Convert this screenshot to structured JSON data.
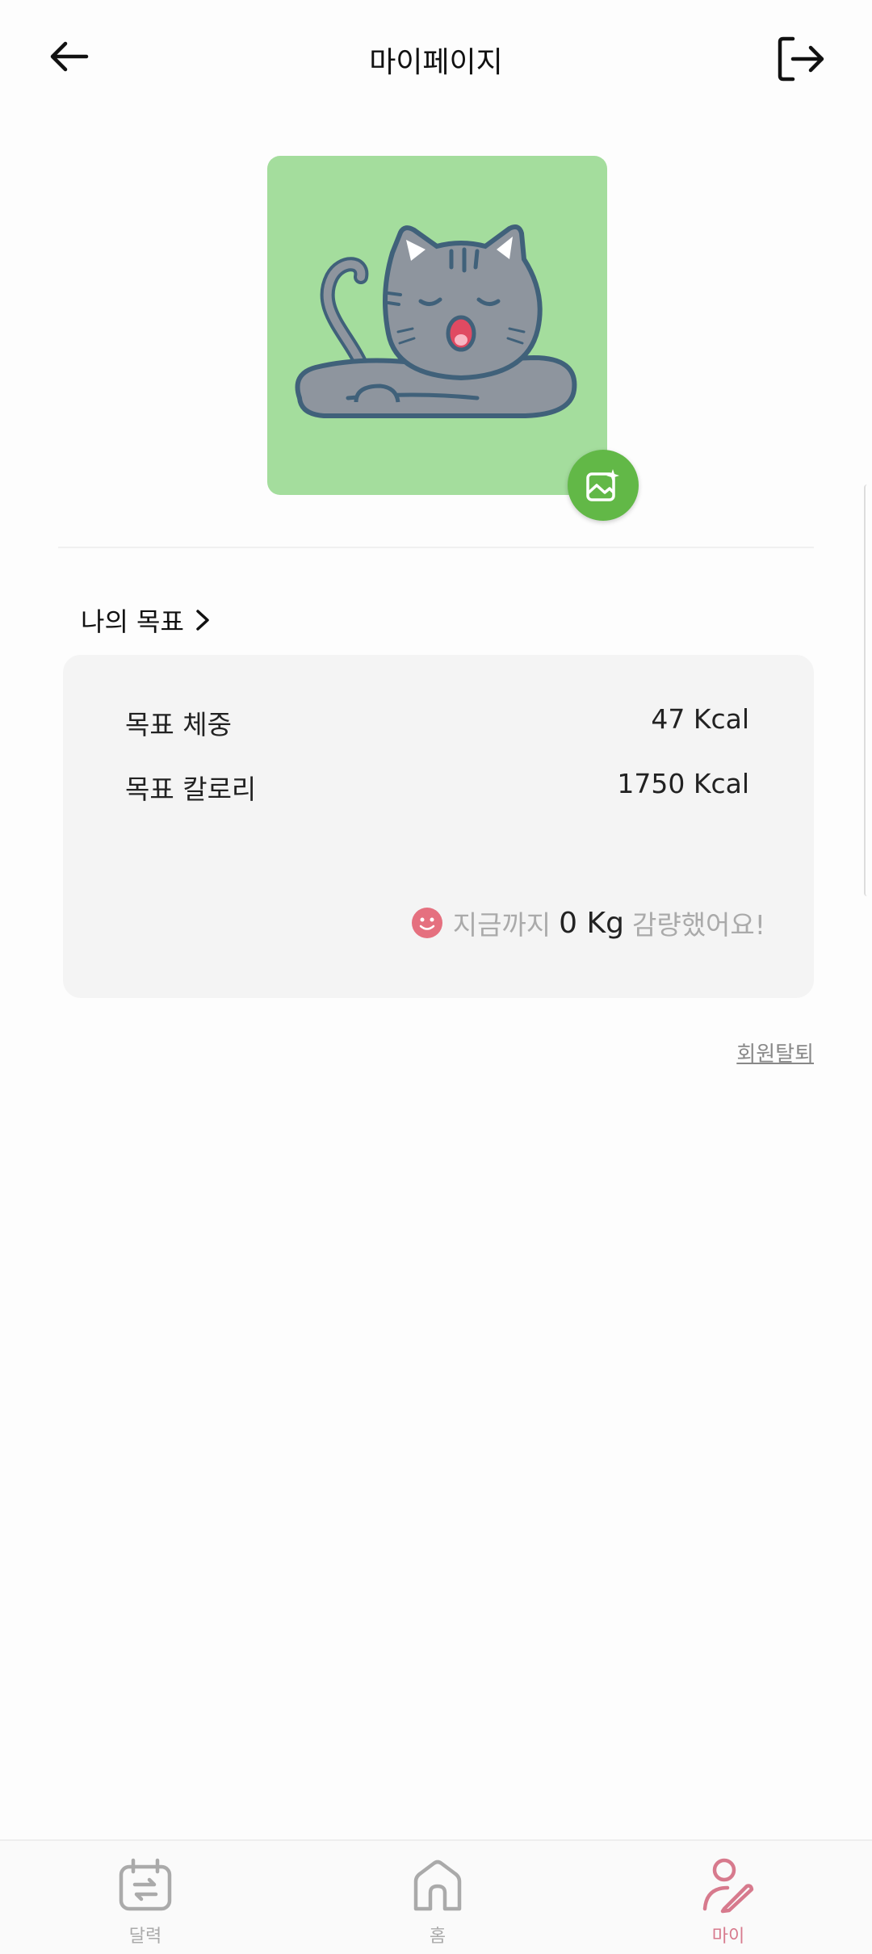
{
  "header": {
    "title": "마이페이지",
    "back_icon": "arrow-left-icon",
    "logout_icon": "logout-icon"
  },
  "profile": {
    "avatar_icon": "sleeping-cat",
    "avatar_bg": "#a4dd9d",
    "edit_button_icon": "image-sparkle-icon",
    "edit_button_color": "#62b847"
  },
  "goals": {
    "section_title": "나의 목표",
    "rows": [
      {
        "label": "목표 체중",
        "value": "47 Kcal"
      },
      {
        "label": "목표 칼로리",
        "value": "1750 Kcal"
      }
    ],
    "progress_prefix": "지금까지",
    "progress_value": "0 Kg",
    "progress_suffix": "감량했어요!"
  },
  "withdraw_label": "회원탈퇴",
  "tabbar": {
    "items": [
      {
        "label": "달력",
        "icon": "calendar-icon",
        "active": false
      },
      {
        "label": "홈",
        "icon": "home-icon",
        "active": false
      },
      {
        "label": "마이",
        "icon": "user-edit-icon",
        "active": true
      }
    ],
    "active_color": "#d77a8d",
    "inactive_color": "#aaaaaa"
  }
}
